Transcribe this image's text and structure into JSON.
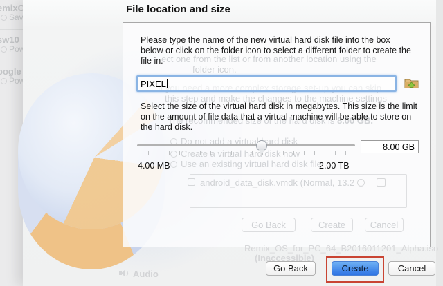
{
  "dialog": {
    "title": "File location and size",
    "intro_text": "Please type the name of the new virtual hard disk file into the box below or click on the folder icon to select a different folder to create the file in.",
    "name_field": {
      "value": "PIXEL"
    },
    "folder_icon": "folder-select-icon",
    "size_text": "Select the size of the virtual hard disk in megabytes. This size is the limit on the amount of file data that a virtual machine will be able to store on the hard disk.",
    "slider": {
      "min_label": "4.00 MB",
      "max_label": "2.00 TB",
      "value": "8.00 GB"
    },
    "buttons": {
      "go_back": "Go Back",
      "create": "Create",
      "cancel": "Cancel"
    }
  },
  "background": {
    "vm_list": [
      {
        "name": "emixO",
        "state": "Save"
      },
      {
        "name": "sw10",
        "state": "Pow"
      },
      {
        "name": "oogle",
        "state": "Pow"
      }
    ],
    "audio_label": "Audio",
    "iso_name": "Remix_OS_for_PC_64_B2016011201_Alpha.iso",
    "iso_status": "(Inaccessible)",
    "watermark": {
      "choose_line1": "ect one from the list or from another location using the",
      "choose_line2": "folder icon.",
      "skip_line1": "If you need a more complex storage set-up you can skip",
      "skip_line2": "this step and make the changes to the machine settings",
      "recommended_prefix": "The recommended size of the hard disk is ",
      "recommended_size": "8.00 GB.",
      "radio_options": [
        "Do not add a virtual hard disk",
        "Create a virtual hard disk now",
        "Use an existing virtual hard disk file"
      ],
      "disk_file_entry": "android_data_disk.vmdk (Normal, 13.2",
      "buttons": {
        "go_back": "Go Back",
        "create": "Create",
        "cancel": "Cancel"
      }
    }
  },
  "colors": {
    "primary_button": "#2f74e4",
    "focus_ring": "#8ab4e4",
    "annotation_red": "#c94433",
    "pie_blue": "#c7d3ec",
    "pie_orange": "#f1c88e"
  }
}
